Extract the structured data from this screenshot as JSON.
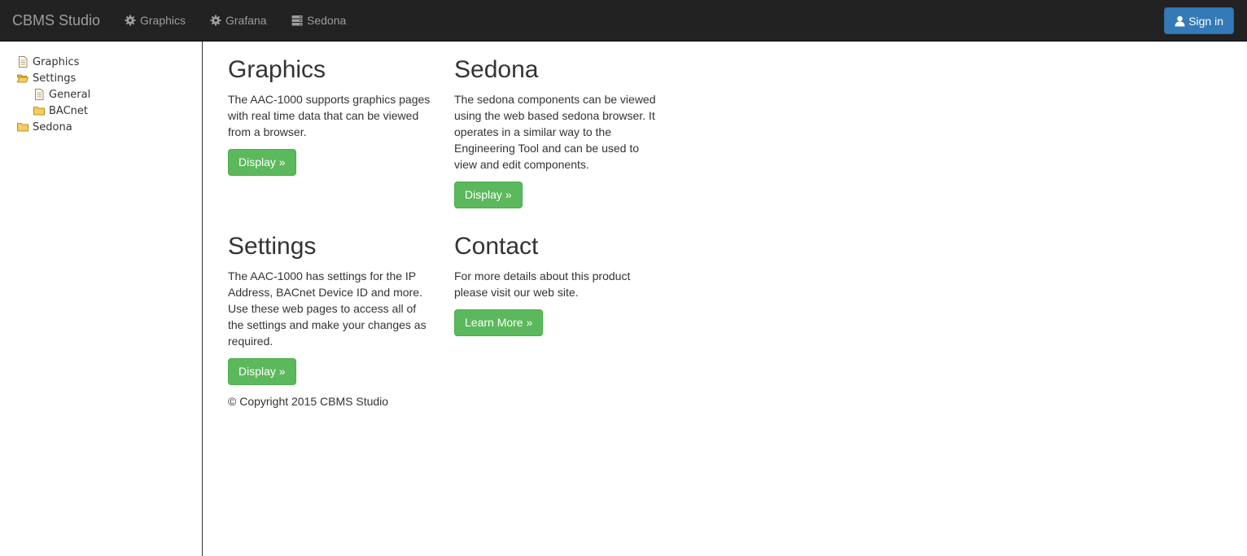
{
  "navbar": {
    "brand": "CBMS Studio",
    "items": [
      {
        "label": "Graphics",
        "icon": "gear-icon"
      },
      {
        "label": "Grafana",
        "icon": "gear-icon"
      },
      {
        "label": "Sedona",
        "icon": "server-icon"
      }
    ],
    "signin_label": "Sign in",
    "signin_icon": "user-icon"
  },
  "sidebar": {
    "items": [
      {
        "label": "Graphics",
        "icon": "file-icon"
      },
      {
        "label": "Settings",
        "icon": "folder-open-icon"
      },
      {
        "label": "General",
        "icon": "file-icon"
      },
      {
        "label": "BACnet",
        "icon": "folder-icon"
      },
      {
        "label": "Sedona",
        "icon": "folder-icon"
      }
    ]
  },
  "main": {
    "sections": [
      {
        "title": "Graphics",
        "text": "The AAC-1000 supports graphics pages with real time data that can be viewed from a browser.",
        "button": "Display »"
      },
      {
        "title": "Sedona",
        "text": "The sedona components can be viewed using the web based sedona browser. It operates in a similar way to the Engineering Tool and can be used to view and edit components.",
        "button": "Display »"
      },
      {
        "title": "Settings",
        "text": "The AAC-1000 has settings for the IP Address, BACnet Device ID and more. Use these web pages to access all of the settings and make your changes as required.",
        "button": "Display »"
      },
      {
        "title": "Contact",
        "text": "For more details about this product please visit our web site.",
        "button": "Learn More »"
      }
    ],
    "footer": "© Copyright 2015 CBMS Studio"
  },
  "colors": {
    "navbar_bg": "#222222",
    "nav_text": "#9d9d9d",
    "primary": "#337ab7",
    "success": "#5cb85c",
    "folder": "#f0c040"
  }
}
